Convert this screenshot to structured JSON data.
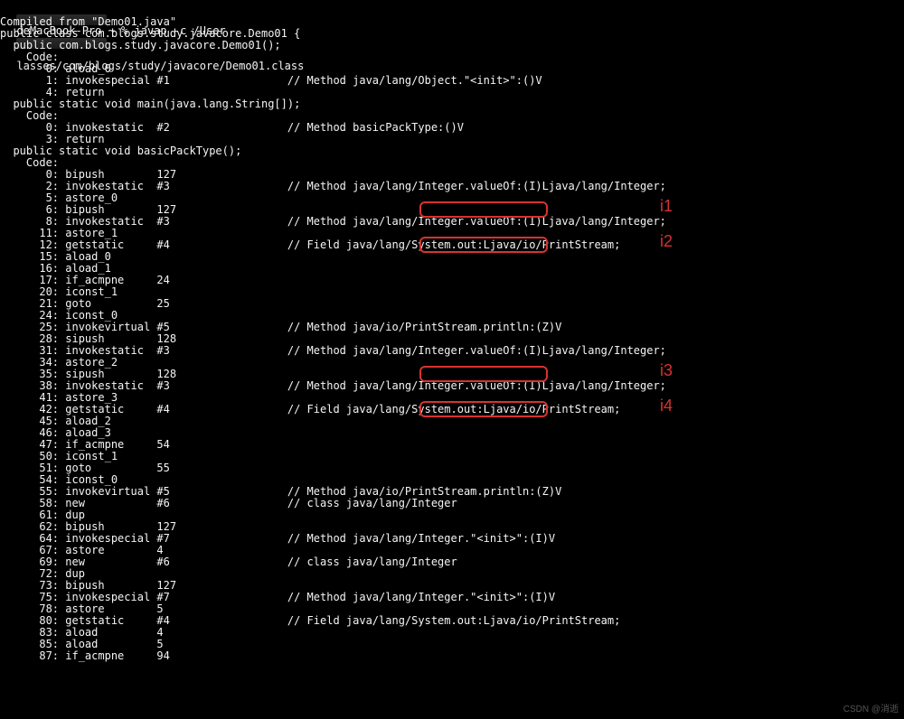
{
  "titlebar": {
    "left": "deMacBook-Pro ~ % javap -c /User",
    "right": "lasses/com/blogs/study/javacore/Demo01.class"
  },
  "lines": [
    "Compiled from \"Demo01.java\"",
    "public class com.blogs.study.javacore.Demo01 {",
    "  public com.blogs.study.javacore.Demo01();",
    "    Code:",
    "       0: aload_0",
    "       1: invokespecial #1                  // Method java/lang/Object.\"<init>\":()V",
    "       4: return",
    "",
    "  public static void main(java.lang.String[]);",
    "    Code:",
    "       0: invokestatic  #2                  // Method basicPackType:()V",
    "       3: return",
    "",
    "  public static void basicPackType();",
    "    Code:",
    "       0: bipush        127",
    "       2: invokestatic  #3                  // Method java/lang/Integer.valueOf:(I)Ljava/lang/Integer;",
    "       5: astore_0",
    "       6: bipush        127",
    "       8: invokestatic  #3                  // Method java/lang/Integer.valueOf:(I)Ljava/lang/Integer;",
    "      11: astore_1",
    "      12: getstatic     #4                  // Field java/lang/System.out:Ljava/io/PrintStream;",
    "      15: aload_0",
    "      16: aload_1",
    "      17: if_acmpne     24",
    "      20: iconst_1",
    "      21: goto          25",
    "      24: iconst_0",
    "      25: invokevirtual #5                  // Method java/io/PrintStream.println:(Z)V",
    "      28: sipush        128",
    "      31: invokestatic  #3                  // Method java/lang/Integer.valueOf:(I)Ljava/lang/Integer;",
    "      34: astore_2",
    "      35: sipush        128",
    "      38: invokestatic  #3                  // Method java/lang/Integer.valueOf:(I)Ljava/lang/Integer;",
    "      41: astore_3",
    "      42: getstatic     #4                  // Field java/lang/System.out:Ljava/io/PrintStream;",
    "      45: aload_2",
    "      46: aload_3",
    "      47: if_acmpne     54",
    "      50: iconst_1",
    "      51: goto          55",
    "      54: iconst_0",
    "      55: invokevirtual #5                  // Method java/io/PrintStream.println:(Z)V",
    "      58: new           #6                  // class java/lang/Integer",
    "      61: dup",
    "      62: bipush        127",
    "      64: invokespecial #7                  // Method java/lang/Integer.\"<init>\":(I)V",
    "      67: astore        4",
    "      69: new           #6                  // class java/lang/Integer",
    "      72: dup",
    "      73: bipush        127",
    "      75: invokespecial #7                  // Method java/lang/Integer.\"<init>\":(I)V",
    "      78: astore        5",
    "      80: getstatic     #4                  // Field java/lang/System.out:Ljava/io/PrintStream;",
    "      83: aload         4",
    "      85: aload         5",
    "      87: if_acmpne     94"
  ],
  "annotations": [
    {
      "label": "i1",
      "line_index": 16
    },
    {
      "label": "i2",
      "line_index": 19
    },
    {
      "label": "i3",
      "line_index": 30
    },
    {
      "label": "i4",
      "line_index": 33
    }
  ],
  "highlight_text": "Integer.valueOf:(I)",
  "footer": "CSDN @消逝"
}
